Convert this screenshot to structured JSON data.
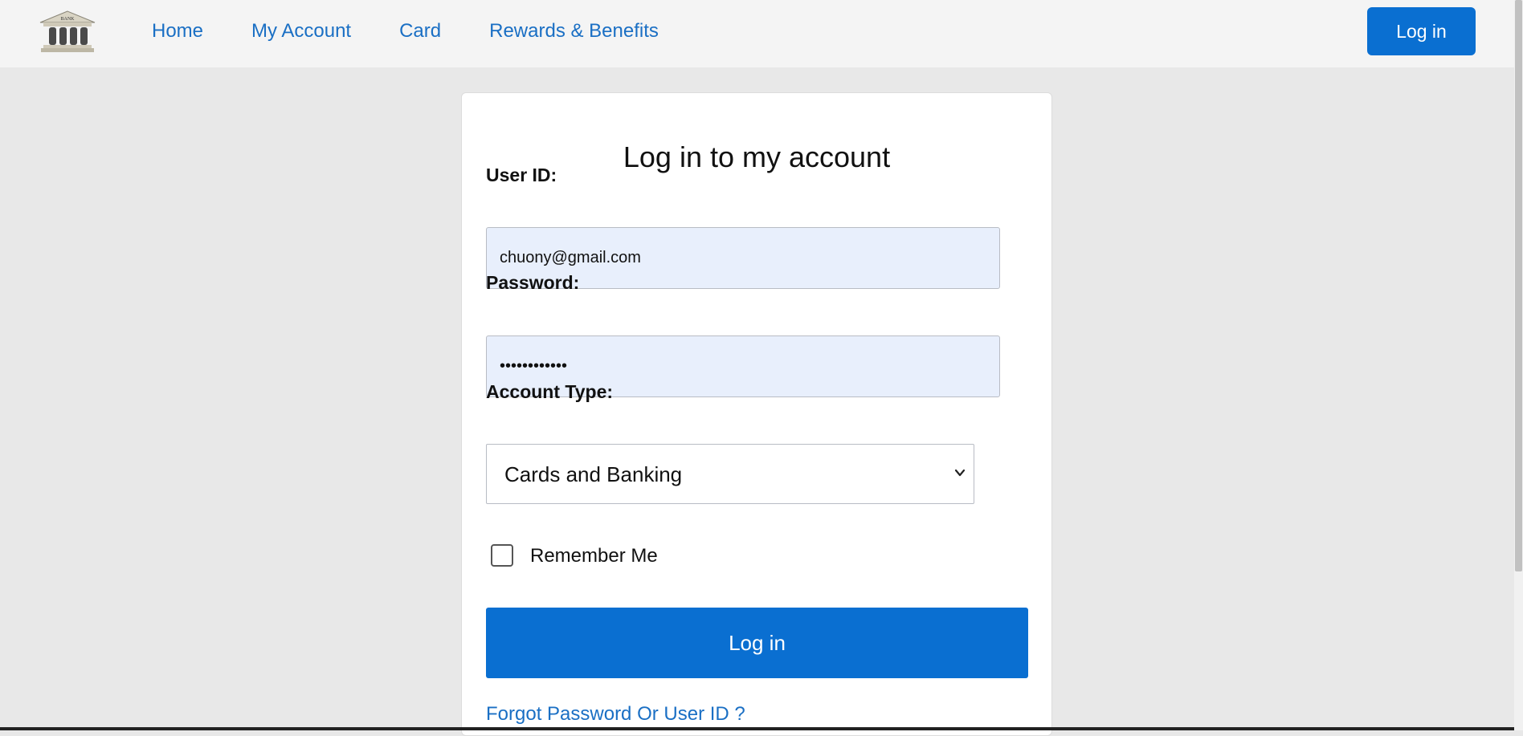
{
  "header": {
    "logo_text": "BANK",
    "nav": [
      "Home",
      "My Account",
      "Card",
      "Rewards & Benefits"
    ],
    "login_label": "Log in"
  },
  "form": {
    "title": "Log in to my account",
    "user_id_label": "User ID:",
    "user_id_value": "chuony@gmail.com",
    "password_label": "Password:",
    "password_value": "••••••••••••",
    "account_type_label": "Account Type:",
    "account_type_value": "Cards and Banking",
    "remember_label": "Remember Me",
    "remember_checked": false,
    "submit_label": "Log in",
    "forgot_label": "Forgot Password Or User ID ?"
  },
  "colors": {
    "accent": "#0a6fd1",
    "link": "#1a6fc4",
    "page_bg": "#e8e8e8",
    "input_bg": "#e8effc"
  },
  "icons": [
    "bank-logo-icon",
    "chevron-down-icon"
  ]
}
